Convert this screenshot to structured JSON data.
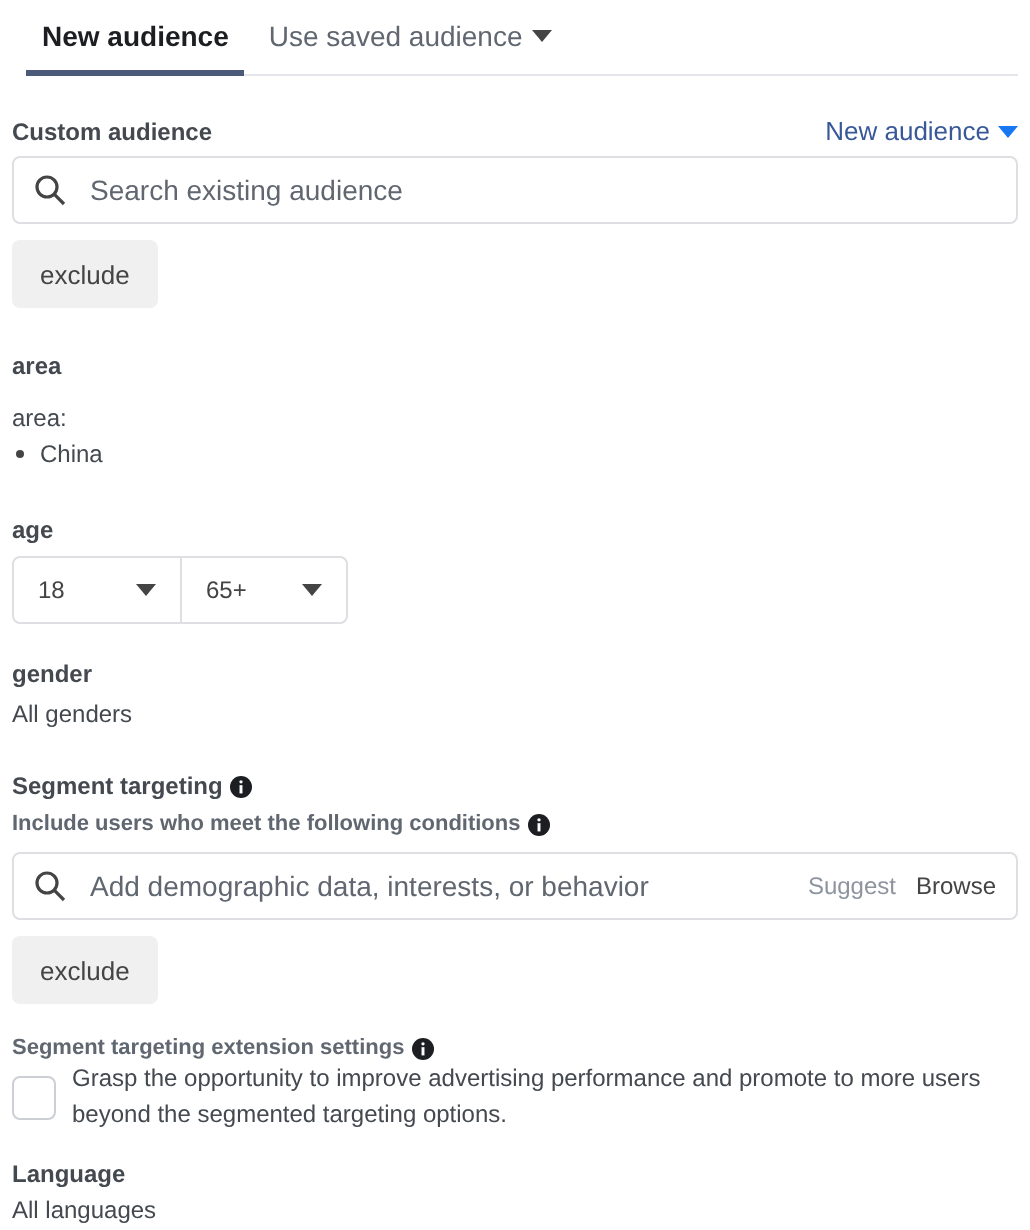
{
  "tabs": [
    {
      "label": "New audience",
      "selected": true,
      "dropdown": false
    },
    {
      "label": "Use saved audience",
      "selected": false,
      "dropdown": true
    }
  ],
  "custom_audience": {
    "label": "Custom audience",
    "link": "New audience",
    "search": {
      "placeholder": "Search existing audience"
    },
    "exclude": "exclude"
  },
  "area": {
    "label": "area",
    "sub_label": "area:",
    "items": [
      "China"
    ]
  },
  "age": {
    "label": "age",
    "min": "18",
    "max": "65+"
  },
  "gender": {
    "label": "gender",
    "value": "All genders"
  },
  "segment": {
    "label": "Segment targeting",
    "hint": "Include users who meet the following conditions",
    "search": {
      "placeholder": "Add demographic data, interests, or behavior"
    },
    "suggest": "Suggest",
    "browse": "Browse",
    "exclude": "exclude"
  },
  "extension": {
    "label": "Segment targeting extension settings",
    "text": "Grasp the opportunity to improve advertising performance and promote to more users beyond the segmented targeting options.",
    "checked": false
  },
  "language": {
    "label": "Language",
    "value": "All languages"
  }
}
